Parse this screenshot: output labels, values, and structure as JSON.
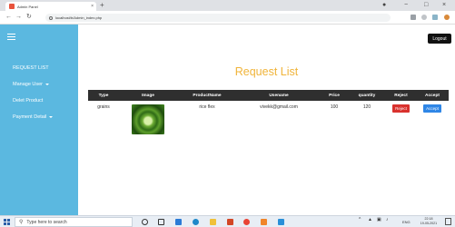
{
  "browser": {
    "tab_title": "Admin Panel",
    "tab_close": "×",
    "new_tab": "+",
    "url": "localhost/b/Admin_index.php",
    "window_controls": {
      "account": "●",
      "minimize": "−",
      "maximize": "□",
      "close": "×"
    }
  },
  "sidebar": {
    "items": [
      {
        "label": "REQUEST LIST"
      },
      {
        "label": "Manage User",
        "dropdown": true
      },
      {
        "label": "Delet Product"
      },
      {
        "label": "Payment Detail",
        "dropdown": true
      }
    ]
  },
  "header": {
    "logout_label": "Logout"
  },
  "main": {
    "title": "Request List"
  },
  "table": {
    "headers": [
      "Type",
      "Image",
      "ProductName",
      "Usename",
      "Price",
      "quantity",
      "Reject",
      "Accept"
    ],
    "rows": [
      {
        "type": "grains",
        "product_name": "rice flex",
        "usename": "vivekk@gmail.com",
        "price": "100",
        "quantity": "120",
        "reject_label": "Reject",
        "accept_label": "Accept"
      }
    ]
  },
  "taskbar": {
    "search_placeholder": "Type here to search",
    "tray_lang": "ENG",
    "tray_time": "22:18",
    "tray_date": "19-05-2021"
  },
  "colors": {
    "sidebar": "#5bb8e0",
    "title": "#f0b43a",
    "table_header": "#2f2f2f",
    "reject": "#d9322e",
    "accept": "#2f86e6"
  }
}
